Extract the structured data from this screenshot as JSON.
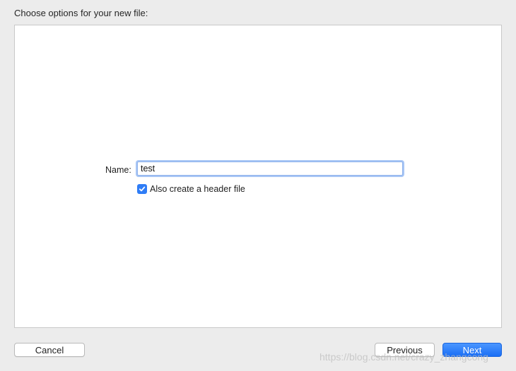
{
  "dialog": {
    "heading": "Choose options for your new file:"
  },
  "form": {
    "name_label": "Name:",
    "name_value": "test",
    "header_checkbox": {
      "label": "Also create a header file",
      "checked": true,
      "color": "#2f7df6"
    }
  },
  "buttons": {
    "cancel_label": "Cancel",
    "previous_label": "Previous",
    "next_label": "Next",
    "primary_color": "#2a7cf7"
  },
  "watermark": {
    "text": "https://blog.csdn.net/crazy_zhangcong"
  }
}
